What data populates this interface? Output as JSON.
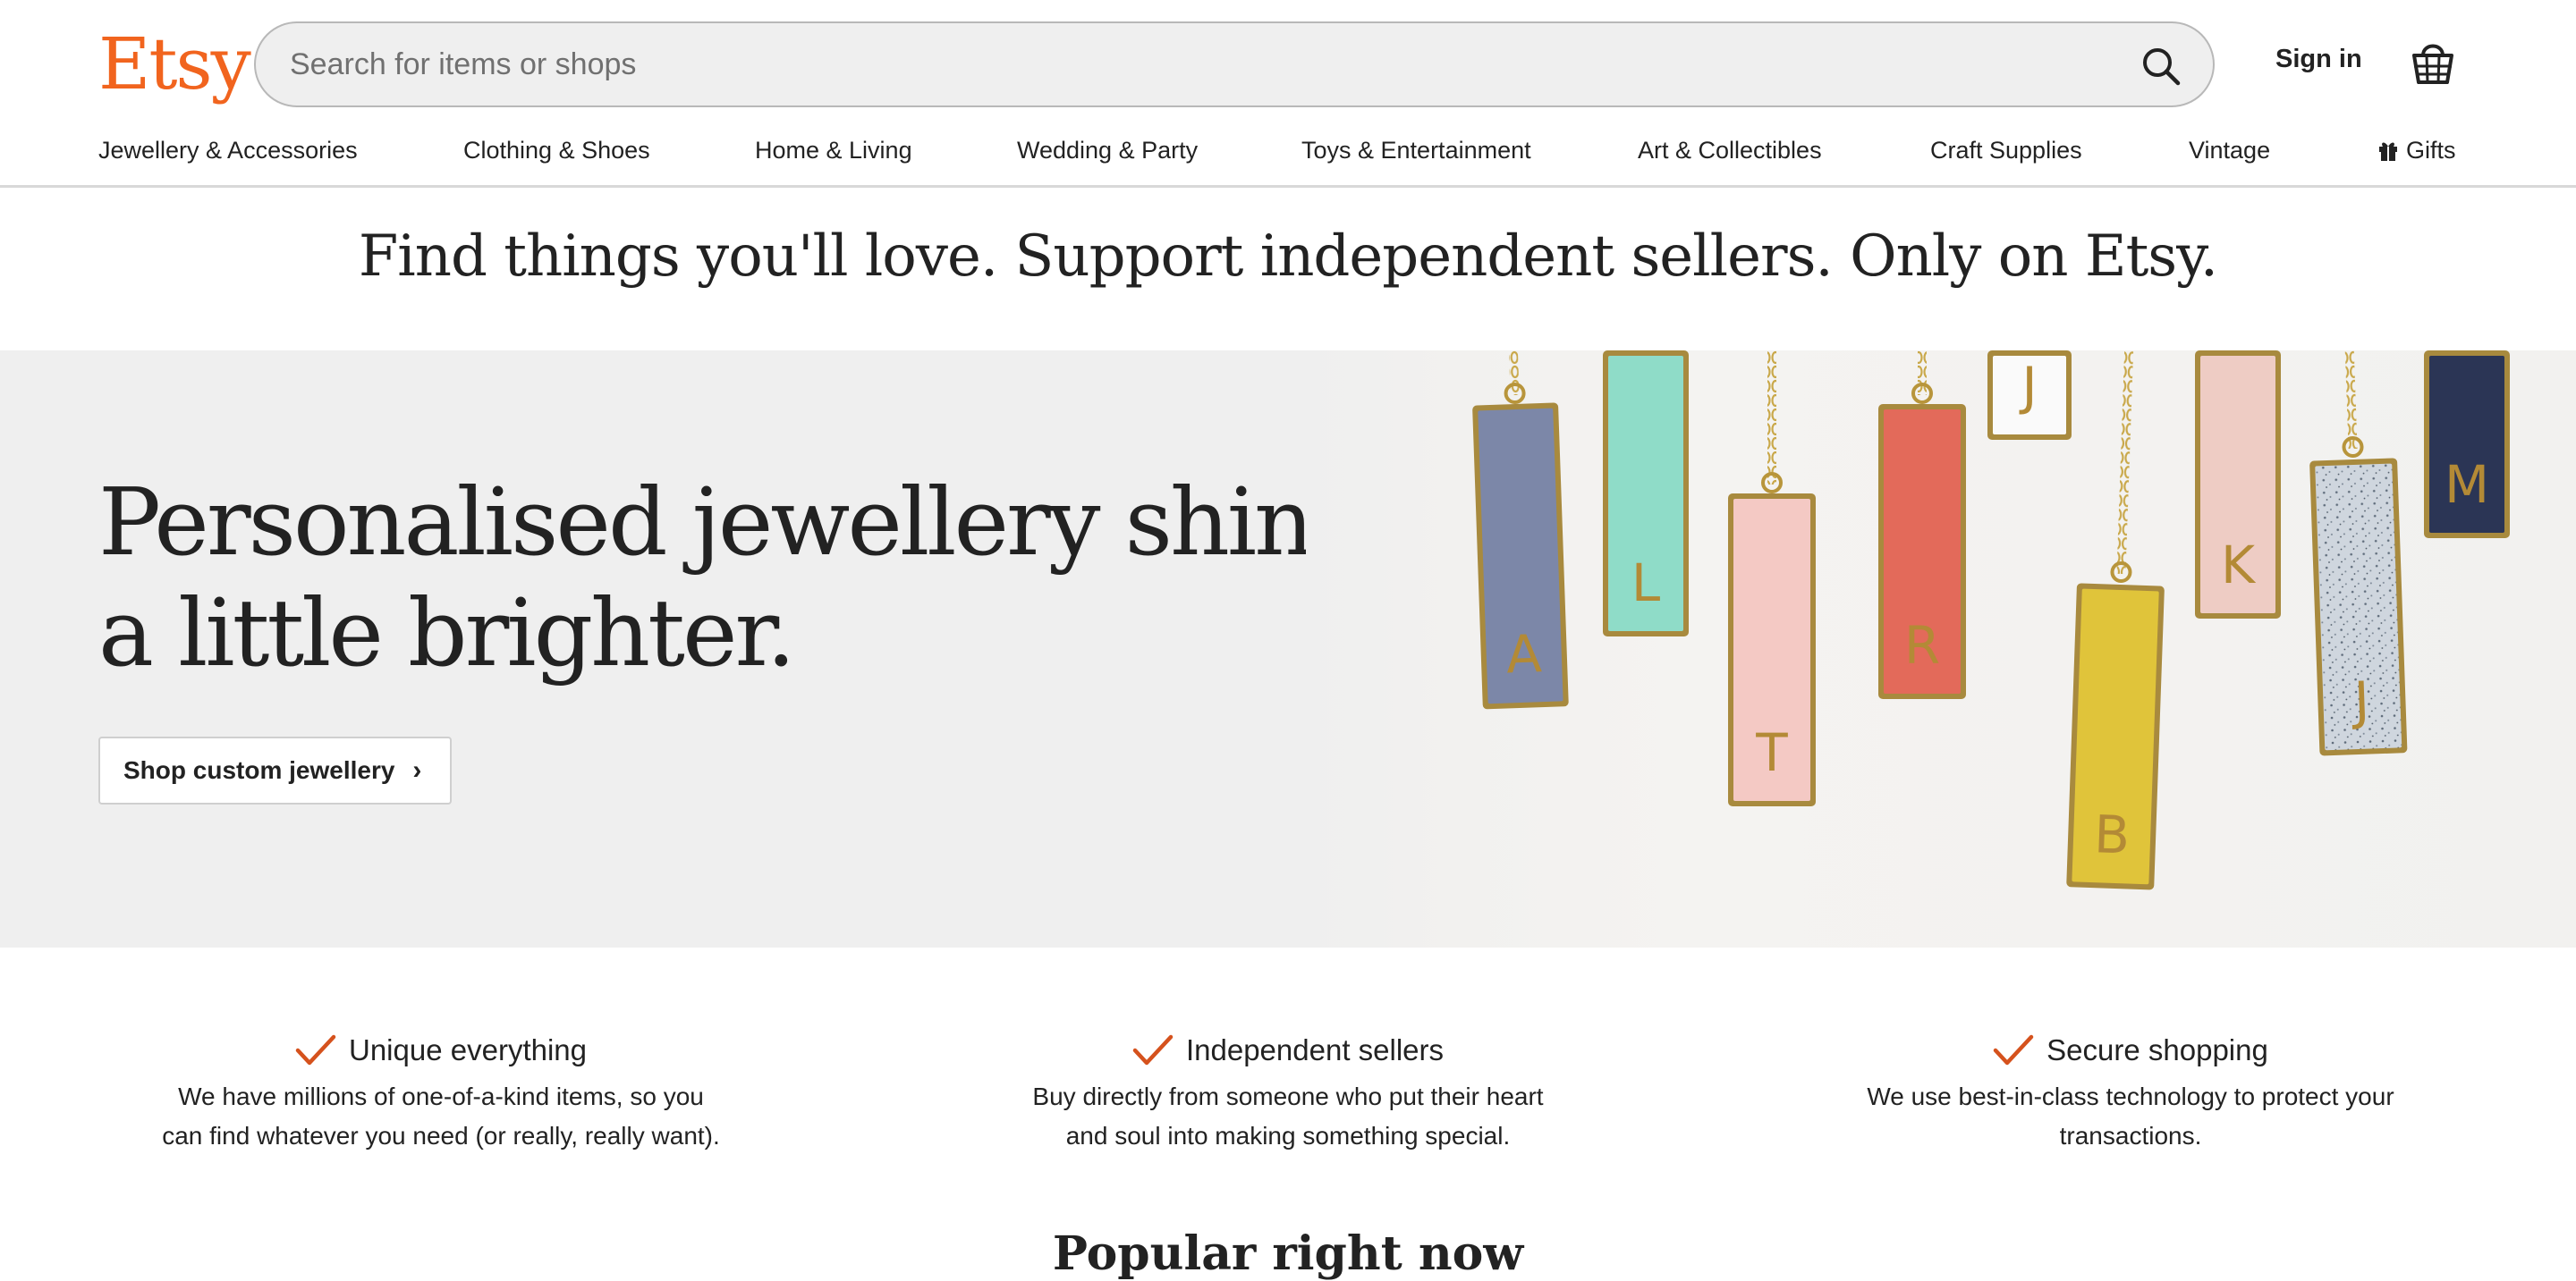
{
  "header": {
    "logo": "Etsy",
    "search_placeholder": "Search for items or shops",
    "signin_label": "Sign in"
  },
  "nav": {
    "items": [
      "Jewellery & Accessories",
      "Clothing & Shoes",
      "Home & Living",
      "Wedding & Party",
      "Toys & Entertainment",
      "Art & Collectibles",
      "Craft Supplies",
      "Vintage",
      "Gifts"
    ]
  },
  "tagline": "Find things you'll love. Support independent sellers. Only on Etsy.",
  "hero": {
    "title_line1": "Personalised jewellery shines",
    "title_line2": "a little brighter.",
    "button_label": "Shop custom jewellery",
    "pendant_letters": [
      "A",
      "L",
      "T",
      "R",
      "J",
      "B",
      "K",
      "J",
      "M"
    ]
  },
  "value_props": [
    {
      "title": "Unique everything",
      "desc_line1": "We have millions of one-of-a-kind items, so you",
      "desc_line2": "can find whatever you need (or really, really want)."
    },
    {
      "title": "Independent sellers",
      "desc_line1": "Buy directly from someone who put their heart",
      "desc_line2": "and soul into making something special."
    },
    {
      "title": "Secure shopping",
      "desc_line1": "We use best-in-class technology to protect your",
      "desc_line2": "transactions."
    }
  ],
  "next_section_peek": "Popular right now",
  "colors": {
    "brand": "#F1641E",
    "text": "#222222",
    "hero_bg": "#efefef",
    "check": "#D5521D"
  }
}
